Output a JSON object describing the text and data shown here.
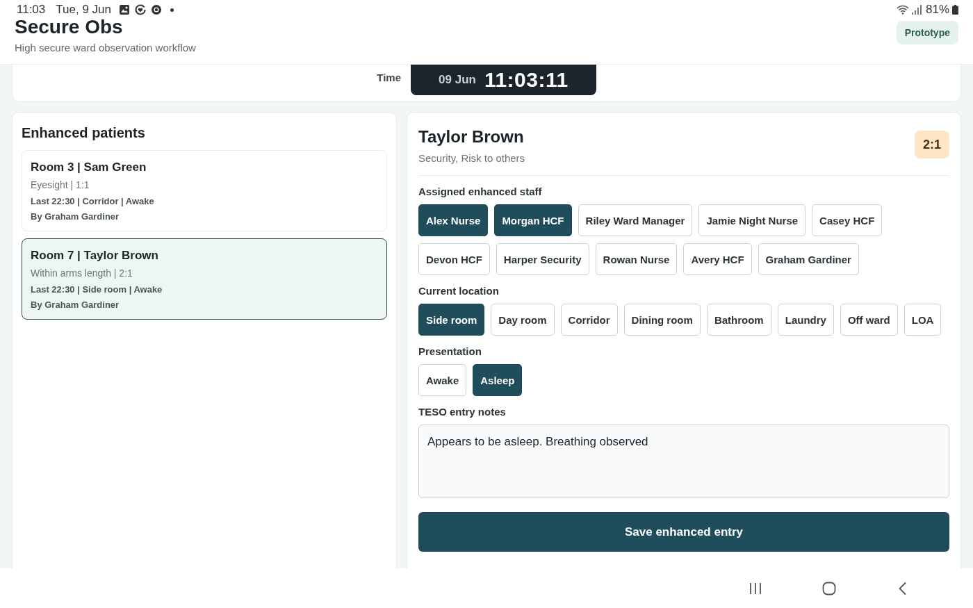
{
  "status_bar": {
    "time": "11:03",
    "date": "Tue, 9 Jun",
    "battery": "81%"
  },
  "header": {
    "title": "Secure Obs",
    "subtitle": "High secure ward observation workflow",
    "badge": "Prototype"
  },
  "clock_card": {
    "label": "Time",
    "date": "09 Jun",
    "time": "11:03:11"
  },
  "patients_panel": {
    "title": "Enhanced patients",
    "patients": [
      {
        "title": "Room 3 | Sam Green",
        "observation": "Eyesight | 1:1",
        "last_entry": "Last 22:30 | Corridor | Awake",
        "recorded_by": "By Graham Gardiner",
        "selected": false
      },
      {
        "title": "Room 7 | Taylor Brown",
        "observation": "Within arms length | 2:1",
        "last_entry": "Last 22:30 | Side room | Awake",
        "recorded_by": "By Graham Gardiner",
        "selected": true
      }
    ]
  },
  "detail": {
    "name": "Taylor Brown",
    "risks": "Security, Risk to others",
    "ratio": "2:1",
    "sections": [
      {
        "label": "Assigned enhanced staff",
        "options": [
          {
            "label": "Alex Nurse",
            "selected": true
          },
          {
            "label": "Morgan HCF",
            "selected": true
          },
          {
            "label": "Riley Ward Manager",
            "selected": false
          },
          {
            "label": "Jamie Night Nurse",
            "selected": false
          },
          {
            "label": "Casey HCF",
            "selected": false
          },
          {
            "label": "Devon HCF",
            "selected": false
          },
          {
            "label": "Harper Security",
            "selected": false
          },
          {
            "label": "Rowan Nurse",
            "selected": false
          },
          {
            "label": "Avery HCF",
            "selected": false
          },
          {
            "label": "Graham Gardiner",
            "selected": false
          }
        ]
      },
      {
        "label": "Current location",
        "options": [
          {
            "label": "Side room",
            "selected": true
          },
          {
            "label": "Day room",
            "selected": false
          },
          {
            "label": "Corridor",
            "selected": false
          },
          {
            "label": "Dining room",
            "selected": false
          },
          {
            "label": "Bathroom",
            "selected": false
          },
          {
            "label": "Laundry",
            "selected": false
          },
          {
            "label": "Off ward",
            "selected": false
          },
          {
            "label": "LOA",
            "selected": false
          }
        ]
      },
      {
        "label": "Presentation",
        "options": [
          {
            "label": "Awake",
            "selected": false
          },
          {
            "label": "Asleep",
            "selected": true
          }
        ]
      }
    ],
    "notes": {
      "label": "TESO entry notes",
      "value": "Appears to be asleep. Breathing observed"
    },
    "save_button": "Save enhanced entry"
  }
}
